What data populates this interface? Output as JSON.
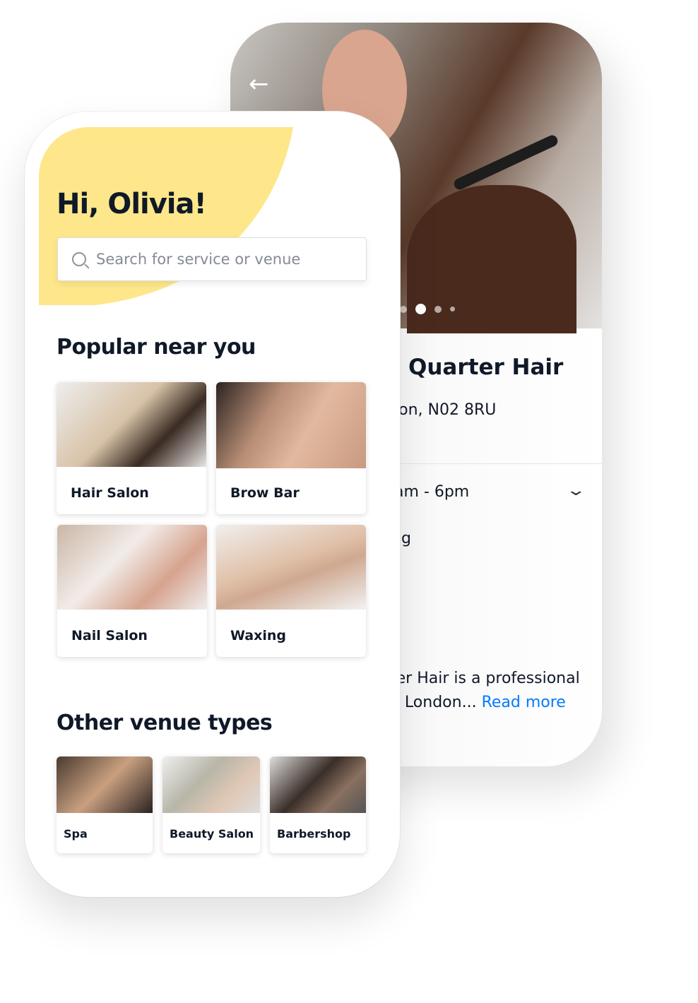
{
  "venue_screen": {
    "back_icon": "arrow-left-icon",
    "carousel": {
      "dots": 4,
      "active": 1
    },
    "name": "Quarter Hair",
    "address": "lon, N02 8RU",
    "hours": "am - 6pm",
    "chevron_icon": "chevron-down-icon",
    "line_fragment": "g",
    "description_1": "ter Hair is a professional",
    "description_2": "n London...",
    "read_more": "Read more",
    "link_color": "#037aff"
  },
  "home_screen": {
    "greeting": "Hi, Olivia!",
    "search": {
      "placeholder": "Search for service or venue",
      "icon": "search-icon"
    },
    "accent_color": "#fee78a",
    "popular_title": "Popular near you",
    "popular": [
      {
        "label": "Hair Salon"
      },
      {
        "label": "Brow Bar"
      },
      {
        "label": "Nail Salon"
      },
      {
        "label": "Waxing"
      }
    ],
    "other_title": "Other venue types",
    "other": [
      {
        "label": "Spa"
      },
      {
        "label": "Beauty Salon"
      },
      {
        "label": "Barbershop"
      }
    ]
  }
}
